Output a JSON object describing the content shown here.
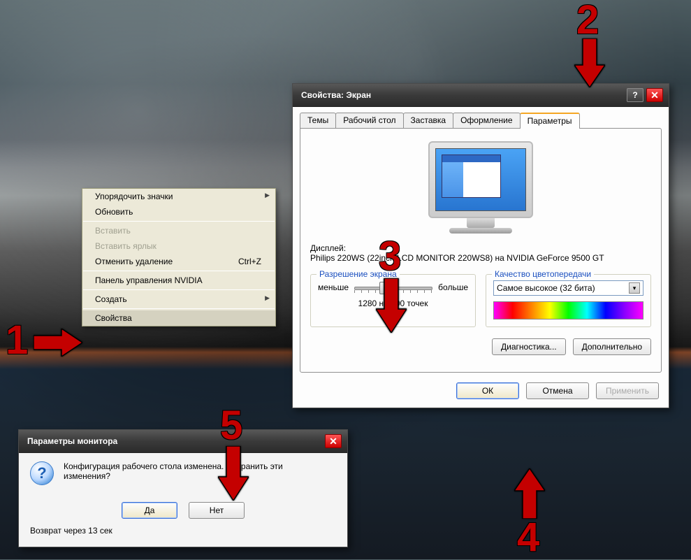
{
  "contextMenu": {
    "items": [
      {
        "label": "Упорядочить значки",
        "submenu": true
      },
      {
        "label": "Обновить"
      },
      {
        "sep": true
      },
      {
        "label": "Вставить",
        "disabled": true
      },
      {
        "label": "Вставить ярлык",
        "disabled": true
      },
      {
        "label": "Отменить удаление",
        "shortcut": "Ctrl+Z"
      },
      {
        "sep": true
      },
      {
        "label": "Панель управления NVIDIA"
      },
      {
        "sep": true
      },
      {
        "label": "Создать",
        "submenu": true
      },
      {
        "sep": true
      },
      {
        "label": "Свойства",
        "hover": true
      }
    ]
  },
  "displayProps": {
    "title": "Свойства: Экран",
    "tabs": [
      "Темы",
      "Рабочий стол",
      "Заставка",
      "Оформление",
      "Параметры"
    ],
    "activeTab": 4,
    "displayLabel": "Дисплей:",
    "displayValue": "Philips 220WS (22inch LCD MONITOR 220WS8) на NVIDIA GeForce 9500 GT",
    "resGroup": {
      "legend": "Разрешение экрана",
      "less": "меньше",
      "more": "больше",
      "current": "1280 на 800 точек"
    },
    "colorGroup": {
      "legend": "Качество цветопередачи",
      "selected": "Самое высокое (32 бита)"
    },
    "diagBtn": "Диагностика...",
    "advBtn": "Дополнительно",
    "okBtn": "ОК",
    "cancelBtn": "Отмена",
    "applyBtn": "Применить"
  },
  "confirm": {
    "title": "Параметры монитора",
    "message": "Конфигурация рабочего стола изменена. Сохранить эти изменения?",
    "countdown": "Возврат через 13 сек",
    "yes": "Да",
    "no": "Нет"
  },
  "annotations": {
    "n1": "1",
    "n2": "2",
    "n3": "3",
    "n4": "4",
    "n5": "5"
  }
}
